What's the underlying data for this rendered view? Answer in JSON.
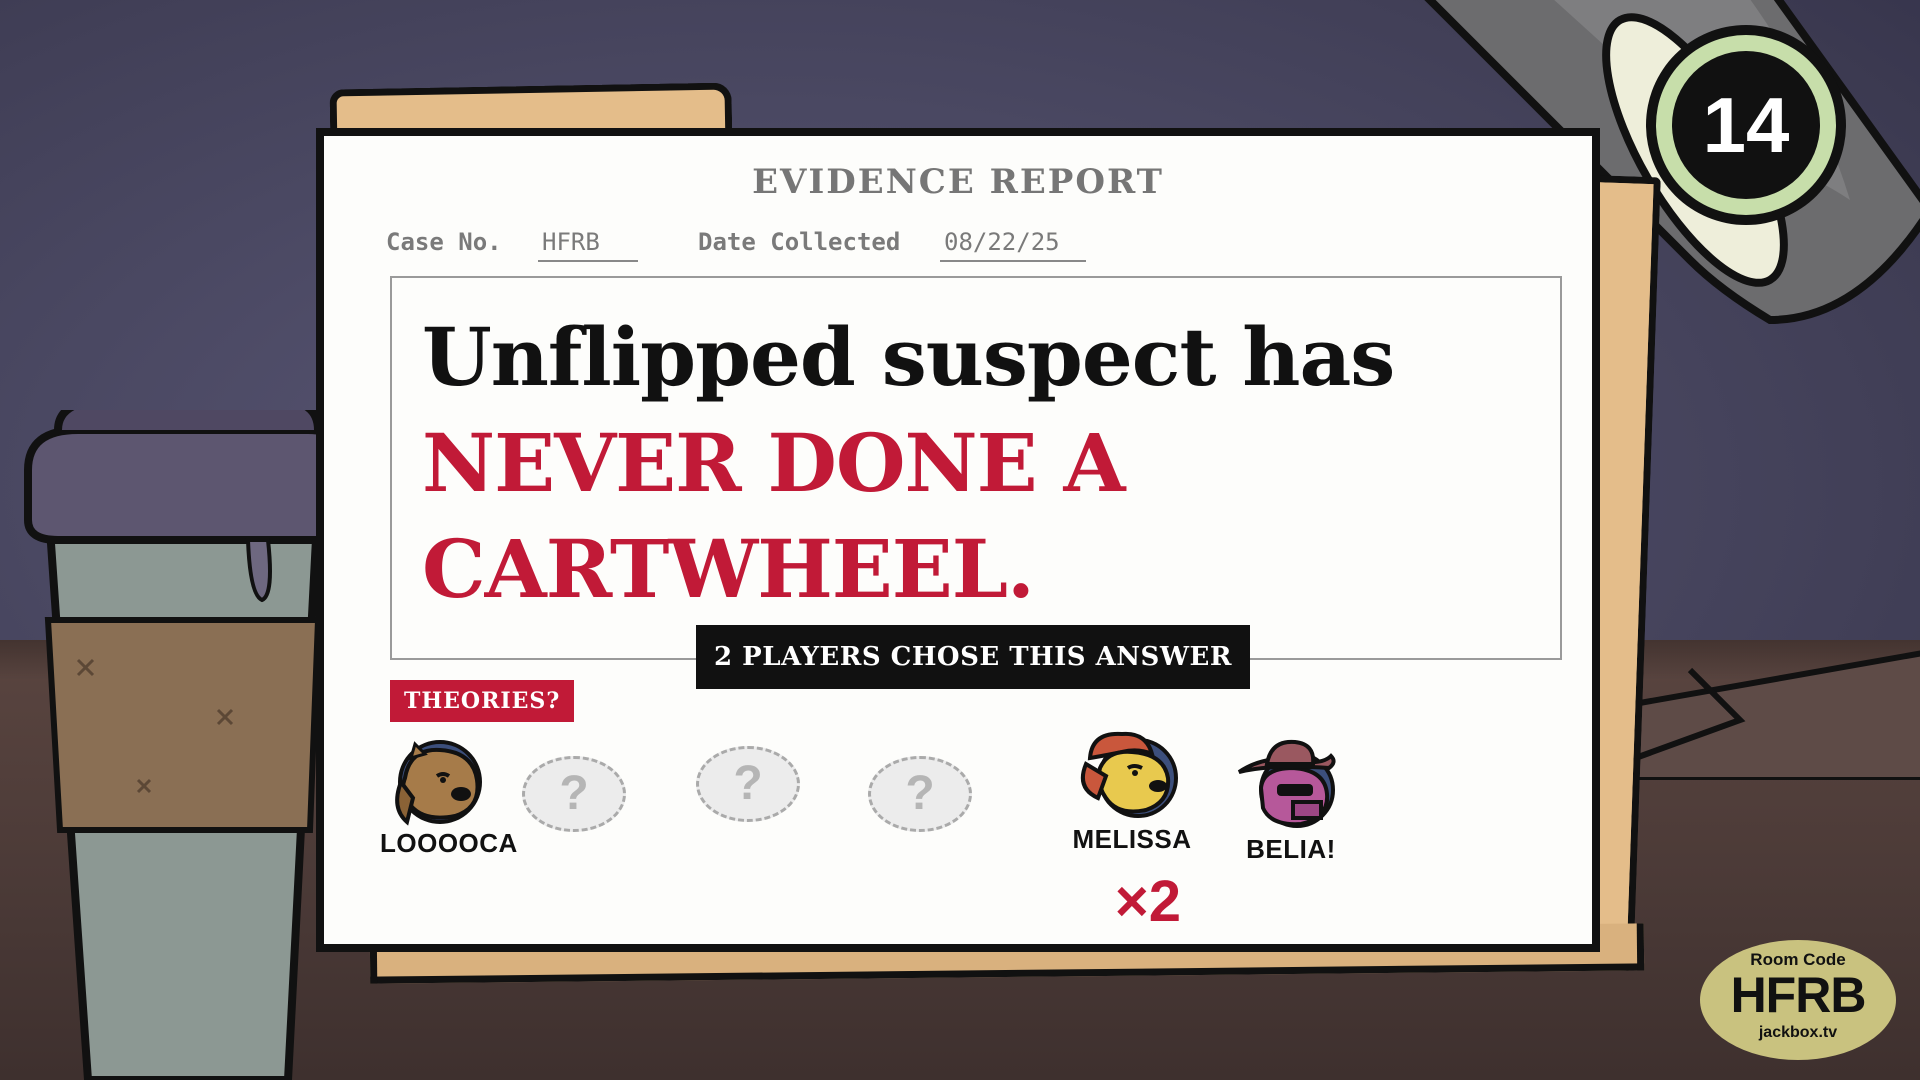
{
  "timer": {
    "seconds": "14"
  },
  "report": {
    "title": "EVIDENCE REPORT",
    "case_label": "Case No.",
    "case_value": "HFRB",
    "date_label": "Date Collected",
    "date_value": "08/22/25"
  },
  "clue": {
    "line1": "Unflipped suspect has",
    "highlight_line2": "NEVER DONE A",
    "highlight_line3": "CARTWHEEL."
  },
  "answer_badge": "2 PLAYERS CHOSE THIS ANSWER",
  "theories_label": "THEORIES?",
  "players": [
    {
      "name": "LOOOOCA",
      "icon": "dog-avatar-icon"
    },
    {
      "name": "?",
      "icon": "unknown-player-icon"
    },
    {
      "name": "?",
      "icon": "unknown-player-icon"
    },
    {
      "name": "?",
      "icon": "unknown-player-icon"
    },
    {
      "name": "MELISSA",
      "icon": "dog-avatar-icon",
      "multiplier": "×2"
    },
    {
      "name": "BELIA!",
      "icon": "cowboy-pig-avatar-icon"
    }
  ],
  "room": {
    "label": "Room Code",
    "code": "HFRB",
    "site": "jackbox.tv"
  },
  "colors": {
    "accent_red": "#c11a37",
    "timer_ring": "#c7deaa",
    "room_badge": "#c9c27f",
    "folder": "#e4bd8a"
  }
}
